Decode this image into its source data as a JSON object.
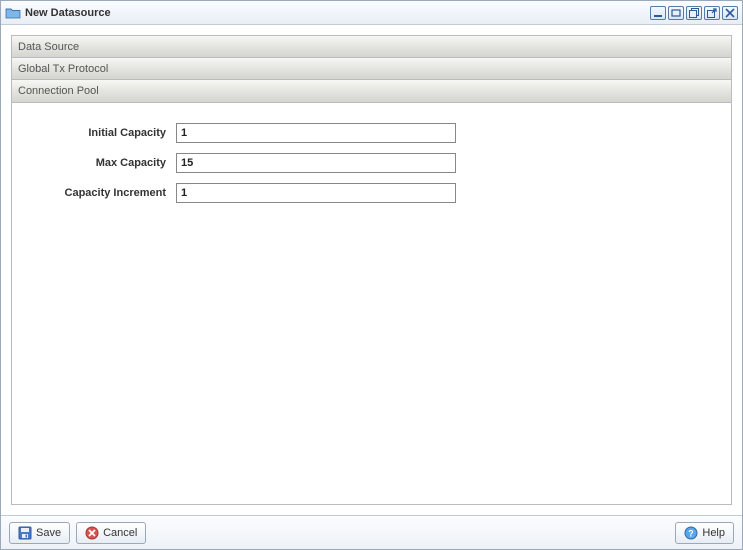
{
  "window": {
    "title": "New Datasource"
  },
  "accordion": {
    "tabs": [
      {
        "label": "Data Source"
      },
      {
        "label": "Global Tx Protocol"
      },
      {
        "label": "Connection Pool"
      }
    ]
  },
  "form": {
    "initial_capacity": {
      "label": "Initial Capacity",
      "value": "1"
    },
    "max_capacity": {
      "label": "Max Capacity",
      "value": "15"
    },
    "capacity_increment": {
      "label": "Capacity Increment",
      "value": "1"
    }
  },
  "footer": {
    "save": "Save",
    "cancel": "Cancel",
    "help": "Help"
  }
}
